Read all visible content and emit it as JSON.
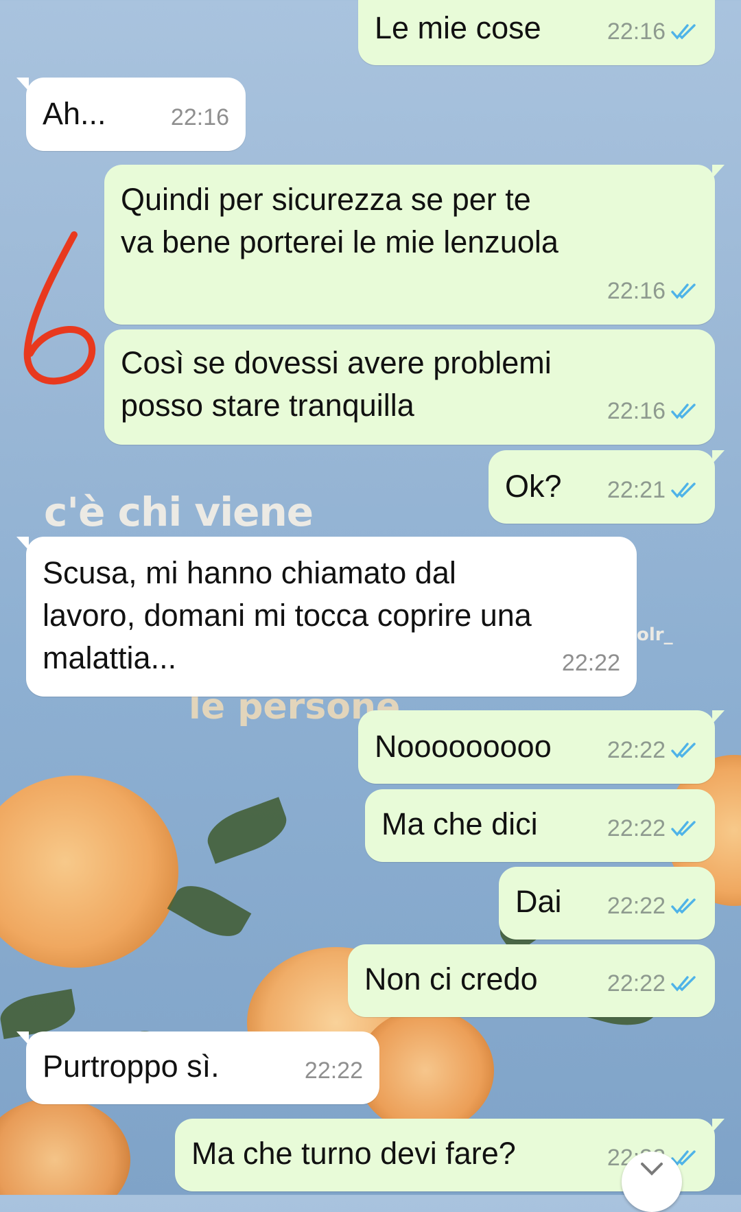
{
  "wallpaper": {
    "line1": "c'è chi viene",
    "line2": "le persone",
    "line3": "olr_"
  },
  "annotation": {
    "mark": "6",
    "color": "#e8391e"
  },
  "colors": {
    "outgoing_bubble": "#e8fbd8",
    "incoming_bubble": "#ffffff",
    "read_tick": "#4fb3e8"
  },
  "messages": [
    {
      "dir": "out",
      "text": "Le mie cose",
      "time": "22:16",
      "read": true
    },
    {
      "dir": "in",
      "text": "Ah...",
      "time": "22:16"
    },
    {
      "dir": "out",
      "text": "Quindi per sicurezza se per te\nva bene porterei le mie lenzuola",
      "time": "22:16",
      "read": true
    },
    {
      "dir": "out",
      "text": "Così se dovessi avere problemi\nposso stare tranquilla",
      "time": "22:16",
      "read": true
    },
    {
      "dir": "out",
      "text": "Ok?",
      "time": "22:21",
      "read": true
    },
    {
      "dir": "in",
      "text": "Scusa, mi hanno chiamato dal\nlavoro, domani mi tocca coprire una\nmalattia...",
      "time": "22:22"
    },
    {
      "dir": "out",
      "text": "Nooooooooo",
      "time": "22:22",
      "read": true
    },
    {
      "dir": "out",
      "text": "Ma che dici",
      "time": "22:22",
      "read": true
    },
    {
      "dir": "out",
      "text": "Dai",
      "time": "22:22",
      "read": true
    },
    {
      "dir": "out",
      "text": "Non ci credo",
      "time": "22:22",
      "read": true
    },
    {
      "dir": "in",
      "text": "Purtroppo sì.",
      "time": "22:22"
    },
    {
      "dir": "out",
      "text": "Ma che turno devi fare?",
      "time": "22:22",
      "read": true
    }
  ]
}
